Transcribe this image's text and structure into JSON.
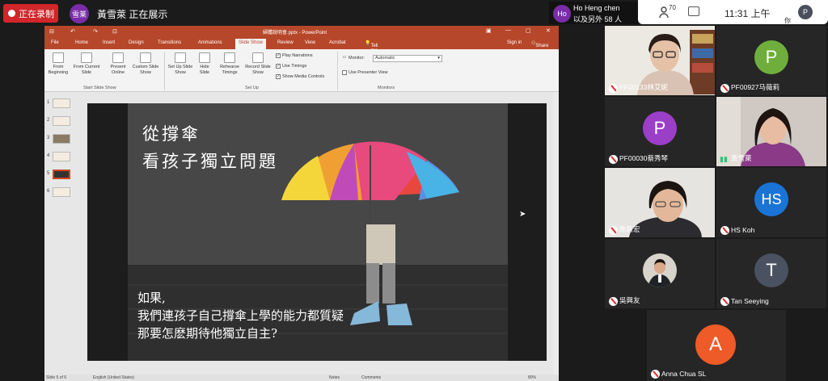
{
  "topbar": {
    "recording_label": "正在录制",
    "presenter_initials": "雪莱",
    "presenting_text": "黃雪萊 正在展示"
  },
  "share_panel": {
    "initials": "Ho",
    "name": "Ho Heng chen",
    "count_text": "以及另外 58 人"
  },
  "status": {
    "participant_count": "70",
    "time": "11:31 上午",
    "user_initial": "P",
    "you_label": "你"
  },
  "ppt": {
    "title": "婦體說明會.pptx - PowerPoint",
    "quick_access": [
      "⊟",
      "↶",
      "↷",
      "⊡"
    ],
    "tabs": [
      "File",
      "Home",
      "Insert",
      "Design",
      "Transitions",
      "Animations",
      "Slide Show",
      "Review",
      "View",
      "Acrobat"
    ],
    "tell_me": "Tell me what you want to do...",
    "sign_in": "Sign in",
    "share": "Share",
    "ribbon": {
      "from_beginning": "From Beginning",
      "from_current": "From Current Slide",
      "present_online": "Present Online",
      "custom_slide_show": "Custom Slide Show",
      "setup_slide_show": "Set Up Slide Show",
      "hide_slide": "Hide Slide",
      "rehearse_timings": "Rehearse Timings",
      "record_slide_show": "Record Slide Show",
      "play_narrations": "Play Narrations",
      "use_timings": "Use Timings",
      "show_media_controls": "Show Media Controls",
      "monitor_label": "Monitor:",
      "monitor_value": "Automatic",
      "use_presenter_view": "Use Presenter View",
      "group_start": "Start Slide Show",
      "group_setup": "Set Up",
      "group_monitors": "Monitors"
    },
    "thumb_numbers": [
      "1",
      "2",
      "3",
      "4",
      "5",
      "6"
    ],
    "selected_thumb": 5,
    "slide": {
      "title_line1": "從撐傘",
      "title_line2": "看孩子獨立問題",
      "body_line1": "如果,",
      "body_line2": "我們連孩子自己撐傘上學的能力都質疑",
      "body_line3": "那要怎麽期待他獨立自主?"
    },
    "status_left": "Slide 5 of 6",
    "status_lang": "English (United States)",
    "status_notes": "Notes",
    "status_comments": "Comments",
    "status_zoom": "80%"
  },
  "participants": [
    {
      "name": "PF00133林艾妮",
      "type": "video",
      "muted": true
    },
    {
      "name": "PF00927马薇莉",
      "type": "avatar",
      "initial": "P",
      "color": "#6fae3c",
      "muted": true
    },
    {
      "name": "PF00030蔡秀琴",
      "type": "avatar",
      "initial": "P",
      "color": "#9b3fc7",
      "muted": true
    },
    {
      "name": "黃雪萊",
      "type": "video",
      "muted": false
    },
    {
      "name": "陈新宏",
      "type": "video",
      "muted": true
    },
    {
      "name": "HS Koh",
      "type": "avatar",
      "initial": "HS",
      "color": "#1a74d6",
      "muted": true
    },
    {
      "name": "吳興友",
      "type": "video",
      "muted": true
    },
    {
      "name": "Tan Seeying",
      "type": "avatar",
      "initial": "T",
      "color": "#4a5261",
      "muted": true
    },
    {
      "name": "Anna Chua SL",
      "type": "avatar",
      "initial": "A",
      "color": "#ee5a28",
      "muted": true
    }
  ]
}
